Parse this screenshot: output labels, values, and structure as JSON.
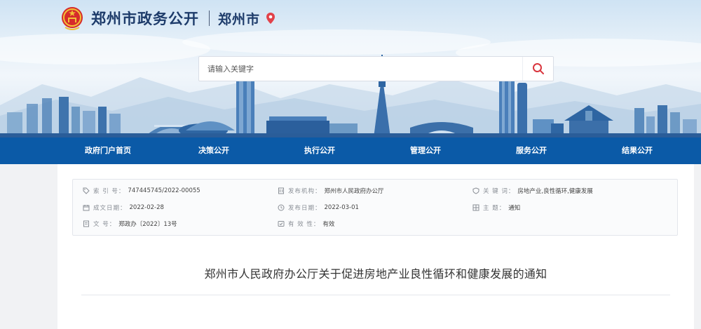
{
  "header": {
    "site_title": "郑州市政务公开",
    "city": "郑州市",
    "icons": {
      "emblem": "national-emblem-icon",
      "location": "location-pin-icon"
    },
    "colors": {
      "title": "#1d3b6a",
      "pin": "#e2424a"
    }
  },
  "search": {
    "placeholder": "请输入关键字",
    "value": "",
    "icon": "search-icon",
    "icon_color": "#d9363e"
  },
  "nav": {
    "background": "#0b5aa7",
    "items": [
      {
        "label": "政府门户首页"
      },
      {
        "label": "决策公开"
      },
      {
        "label": "执行公开"
      },
      {
        "label": "管理公开"
      },
      {
        "label": "服务公开"
      },
      {
        "label": "结果公开"
      }
    ]
  },
  "meta": {
    "items": [
      {
        "icon": "tag-icon",
        "label": "索  引  号：",
        "value": "747445745/2022-00055"
      },
      {
        "icon": "building-icon",
        "label": "发布机构：",
        "value": "郑州市人民政府办公厅"
      },
      {
        "icon": "shield-icon",
        "label": "关  键  词：",
        "value": "房地产业,良性循环,健康发展"
      },
      {
        "icon": "calendar-icon",
        "label": "成文日期：",
        "value": "2022-02-28"
      },
      {
        "icon": "clock-icon",
        "label": "发布日期：",
        "value": "2022-03-01"
      },
      {
        "icon": "category-icon",
        "label": "主        题：",
        "value": "通知"
      },
      {
        "icon": "document-icon",
        "label": "文        号：",
        "value": "郑政办〔2022〕13号"
      },
      {
        "icon": "validity-icon",
        "label": "有  效  性：",
        "value": "有效"
      }
    ]
  },
  "document": {
    "title": "郑州市人民政府办公厅关于促进房地产业良性循环和健康发展的通知"
  }
}
